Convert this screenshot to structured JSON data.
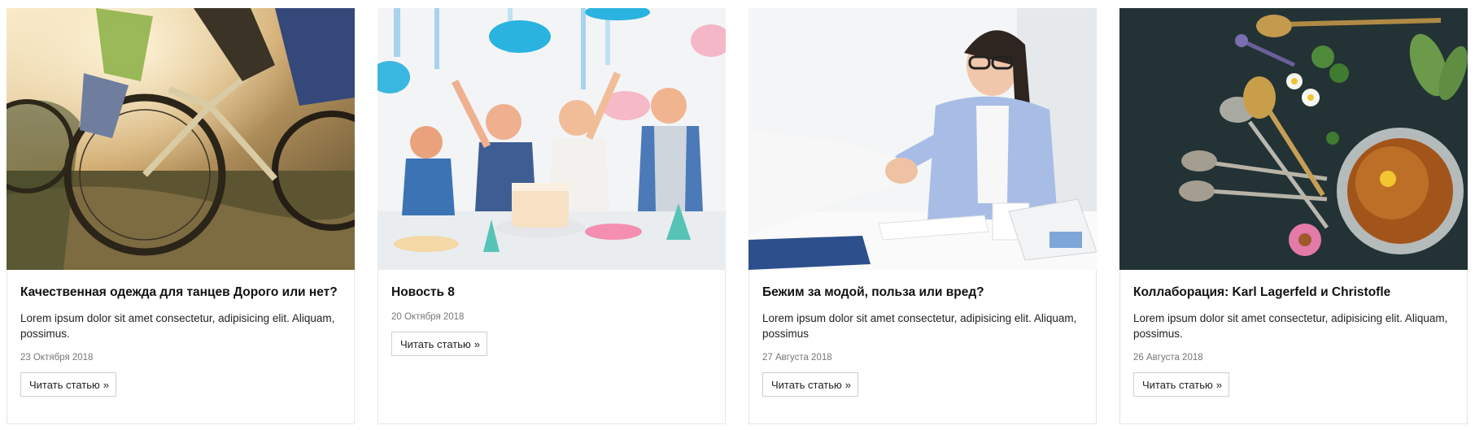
{
  "cards": [
    {
      "image": "bicycle-riders-photo",
      "title": "Качественная одежда для танцев Дорого или нет?",
      "excerpt": "Lorem ipsum dolor sit amet consectetur, adipisicing elit. Aliquam, possimus.",
      "date": "23 Октября 2018",
      "button": "Читать статью",
      "chevron": "»"
    },
    {
      "image": "kids-party-photo",
      "title": "Новость 8",
      "excerpt": "",
      "date": "20 Октября 2018",
      "button": "Читать статью",
      "chevron": "»"
    },
    {
      "image": "business-handshake-photo",
      "title": "Бежим за модой, польза или вред?",
      "excerpt": "Lorem ipsum dolor sit amet consectetur, adipisicing elit. Aliquam, possimus",
      "date": "27 Августа 2018",
      "button": "Читать статью",
      "chevron": "»"
    },
    {
      "image": "herbal-tea-photo",
      "title": "Коллаборация: Karl Lagerfeld и Christofle",
      "excerpt": "Lorem ipsum dolor sit amet consectetur, adipisicing elit. Aliquam, possimus.",
      "date": "26 Августа 2018",
      "button": "Читать статью",
      "chevron": "»"
    }
  ]
}
